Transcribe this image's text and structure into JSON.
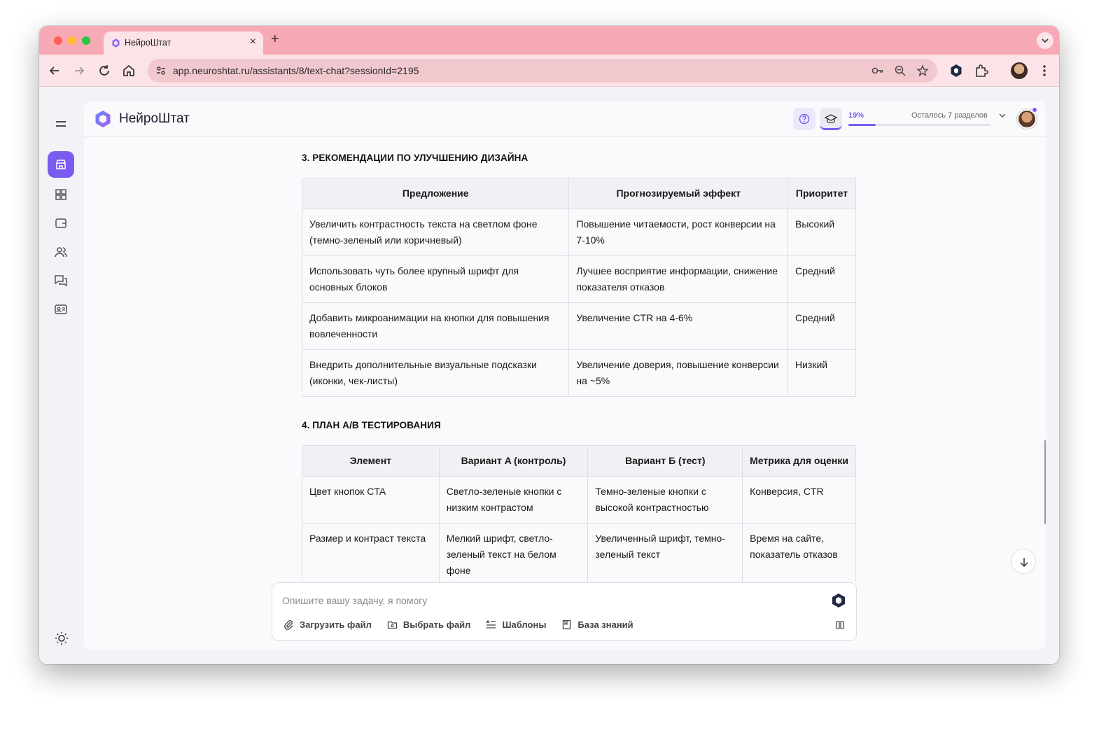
{
  "browser": {
    "tab_title": "НейроШтат",
    "url": "app.neuroshtat.ru/assistants/8/text-chat?sessionId=2195",
    "new_tab_symbol": "+",
    "close_symbol": "×",
    "dropdown_symbol": "⌄"
  },
  "app": {
    "brand": "НейроШтат",
    "progress": {
      "percent_label": "19%",
      "value": 0.19,
      "remaining_label": "Осталось 7 разделов"
    },
    "sidebar": {
      "items": [
        "store-icon",
        "dashboard-icon",
        "wallet-icon",
        "users-icon",
        "chat-icon",
        "id-card-icon"
      ]
    }
  },
  "sections": [
    {
      "title": "3. РЕКОМЕНДАЦИИ ПО УЛУЧШЕНИЮ ДИЗАЙНА",
      "headers": [
        "Предложение",
        "Прогнозируемый эффект",
        "Приоритет"
      ],
      "rows": [
        [
          "Увеличить контрастность текста на светлом фоне (темно-зеленый или коричневый)",
          "Повышение читаемости, рост конверсии на 7-10%",
          "Высокий"
        ],
        [
          "Использовать чуть более крупный шрифт для основных блоков",
          "Лучшее восприятие информации, снижение показателя отказов",
          "Средний"
        ],
        [
          "Добавить микроанимации на кнопки для повышения вовлеченности",
          "Увеличение CTR на 4-6%",
          "Средний"
        ],
        [
          "Внедрить дополнительные визуальные подсказки (иконки, чек-листы)",
          "Увеличение доверия, повышение конверсии на ~5%",
          "Низкий"
        ]
      ]
    },
    {
      "title": "4. ПЛАН A/B ТЕСТИРОВАНИЯ",
      "headers": [
        "Элемент",
        "Вариант A (контроль)",
        "Вариант Б (тест)",
        "Метрика для оценки"
      ],
      "rows": [
        [
          "Цвет кнопок CTA",
          "Светло-зеленые кнопки с низким контрастом",
          "Темно-зеленые кнопки с высокой контрастностью",
          "Конверсия, CTR"
        ],
        [
          "Размер и контраст текста",
          "Мелкий шрифт, светло-зеленый текст на белом фоне",
          "Увеличенный шрифт, темно-зеленый текст",
          "Время на сайте, показатель отказов"
        ]
      ]
    }
  ],
  "composer": {
    "placeholder": "Опишите вашу задачу, я помогу",
    "actions": [
      "Загрузить файл",
      "Выбрать файл",
      "Шаблоны",
      "База знаний"
    ]
  },
  "colors": {
    "accent": "#7b5cf0",
    "titlebar": "#f7aab6",
    "toolbar": "#fbe3e7"
  }
}
